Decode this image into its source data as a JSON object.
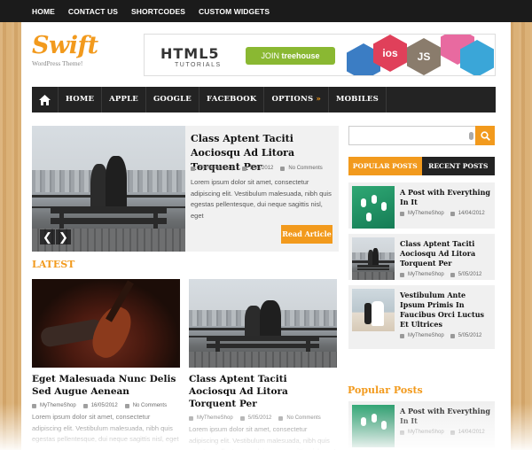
{
  "top_nav": [
    "HOME",
    "CONTACT US",
    "SHORTCODES",
    "CUSTOM WIDGETS"
  ],
  "logo": {
    "title": "Swift",
    "tagline": "WordPress Theme!"
  },
  "banner": {
    "headline": "HTML5",
    "sub": "TUTORIALS",
    "cta_prefix": "JOIN",
    "cta_brand": "treehouse",
    "badges": [
      "ios",
      "JS"
    ]
  },
  "main_nav": {
    "items": [
      "HOME",
      "APPLE",
      "GOOGLE",
      "FACEBOOK",
      "OPTIONS",
      "MOBILES"
    ],
    "options_suffix": "»"
  },
  "slider": {
    "title": "Class Aptent Taciti Aociosqu Ad Litora Torquent Per",
    "author": "MyThemeShop",
    "date": "5/05/2012",
    "comments": "No Comments",
    "excerpt": "Lorem ipsum dolor sit amet, consectetur adipiscing elit. Vestibulum malesuada, nibh quis egestas pellentesque, dui neque sagittis nisl, eget",
    "read_more": "Read Article",
    "prev": "❮",
    "next": "❯"
  },
  "latest_heading": "LATEST",
  "latest_posts": [
    {
      "title": "Eget Malesuada Nunc Delis Sed Augue Aenean",
      "author": "MyThemeShop",
      "date": "16/05/2012",
      "comments": "No Comments",
      "excerpt": "Lorem ipsum dolor sit amet, consectetur adipiscing elit. Vestibulum malesuada, nibh quis egestas pellentesque, dui neque sagittis nisl, eget"
    },
    {
      "title": "Class Aptent Taciti Aociosqu Ad Litora Torquent Per",
      "author": "MyThemeShop",
      "date": "5/05/2012",
      "comments": "No Comments",
      "excerpt": "Lorem ipsum dolor sit amet, consectetur adipiscing elit. Vestibulum malesuada, nibh quis egestas pellentesque, dui neque sagittis nisl, eget"
    }
  ],
  "sidebar": {
    "tabs": [
      "POPULAR POSTS",
      "RECENT POSTS"
    ],
    "posts": [
      {
        "title": "A Post with Everything In It",
        "author": "MyThemeShop",
        "date": "14/04/2012"
      },
      {
        "title": "Class Aptent Taciti Aociosqu Ad Litora Torquent Per",
        "author": "MyThemeShop",
        "date": "5/05/2012"
      },
      {
        "title": "Vestibulum Ante Ipsum Primis In Faucibus Orci Luctus Et Ultrices",
        "author": "MyThemeShop",
        "date": "5/05/2012"
      }
    ],
    "popular_heading": "Popular Posts",
    "popular": [
      {
        "title": "A Post with Everything In It",
        "author": "MyThemeShop",
        "date": "14/04/2012"
      }
    ]
  },
  "colors": {
    "accent": "#f29a1d",
    "dark": "#232323",
    "wood": "#d9ad70"
  }
}
